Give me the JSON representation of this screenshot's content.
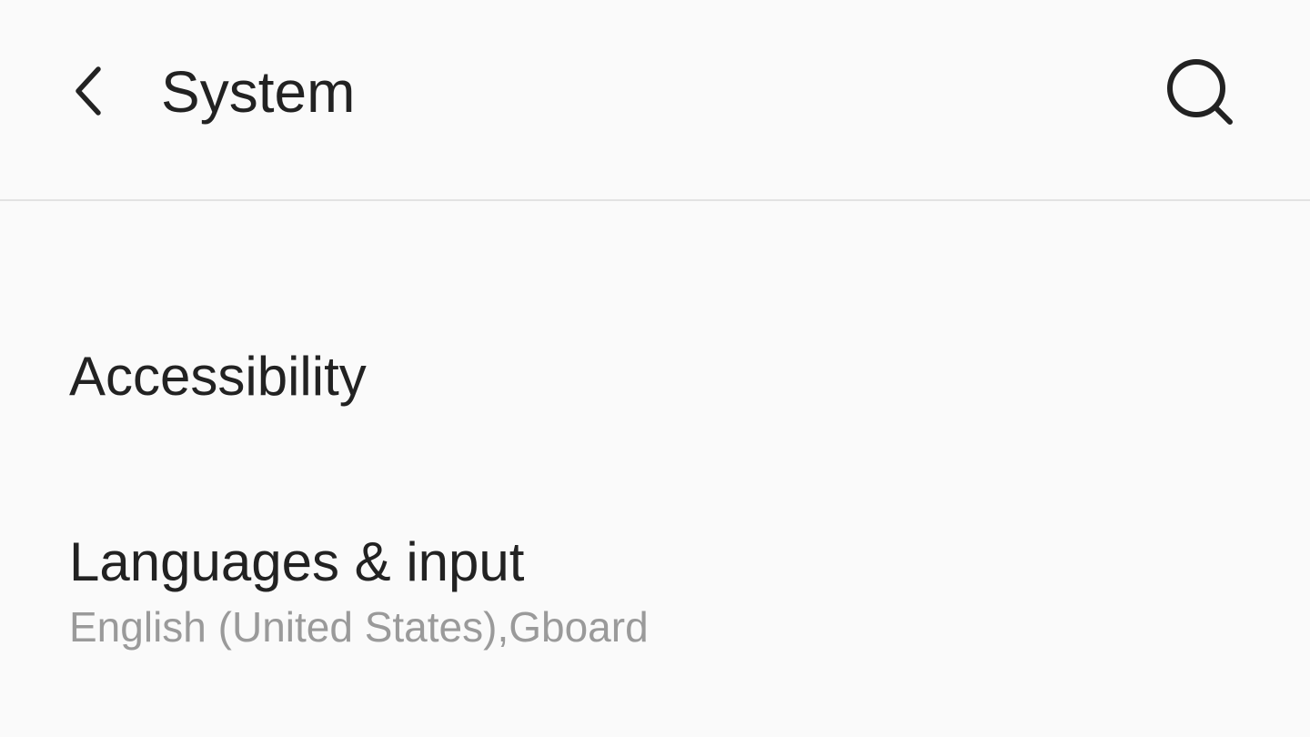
{
  "header": {
    "title": "System",
    "back_icon": "chevron-left-icon",
    "search_icon": "search-icon"
  },
  "settings": {
    "items": [
      {
        "title": "Accessibility",
        "summary": ""
      },
      {
        "title": "Languages & input",
        "summary": "English (United States),Gboard"
      }
    ]
  },
  "colors": {
    "background": "#fafafa",
    "primary_text": "#222222",
    "secondary_text": "#9a9a9a",
    "divider": "#e2e2e2"
  }
}
